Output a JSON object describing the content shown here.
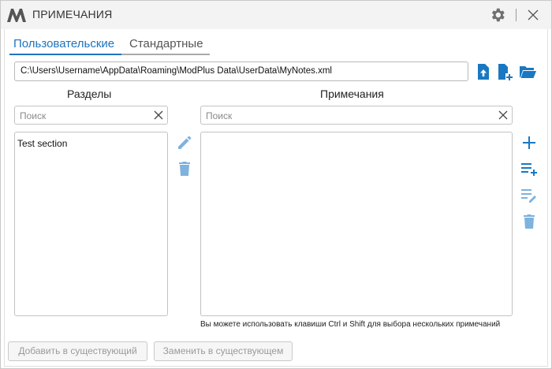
{
  "window": {
    "title": "ПРИМЕЧАНИЯ",
    "icons": {
      "logo": "modplus-logo-icon",
      "settings": "gear-icon",
      "close": "close-icon"
    }
  },
  "tabs": [
    {
      "label": "Пользовательские",
      "active": true
    },
    {
      "label": "Стандартные",
      "active": false
    }
  ],
  "file": {
    "path": "C:\\Users\\Username\\AppData\\Roaming\\ModPlus Data\\UserData\\MyNotes.xml",
    "icons": [
      "file-upload-icon",
      "new-file-icon",
      "open-folder-icon"
    ]
  },
  "sections": {
    "title": "Разделы",
    "search_placeholder": "Поиск",
    "items": [
      "Test section"
    ],
    "icons": [
      "edit-icon",
      "delete-icon"
    ]
  },
  "notes": {
    "title": "Примечания",
    "search_placeholder": "Поиск",
    "items": [],
    "hint": "Вы можете использовать клавиши Ctrl и Shift для выбора нескольких примечаний",
    "icons": [
      "add-icon",
      "add-list-icon",
      "edit-list-icon",
      "delete-icon"
    ]
  },
  "buttons": {
    "add_to_existing": "Добавить в существующий",
    "replace_in_existing": "Заменить в существующем"
  },
  "colors": {
    "accent": "#1e73be",
    "icon_blue": "#1a78c2",
    "icon_disabled": "#7fb2dd"
  }
}
